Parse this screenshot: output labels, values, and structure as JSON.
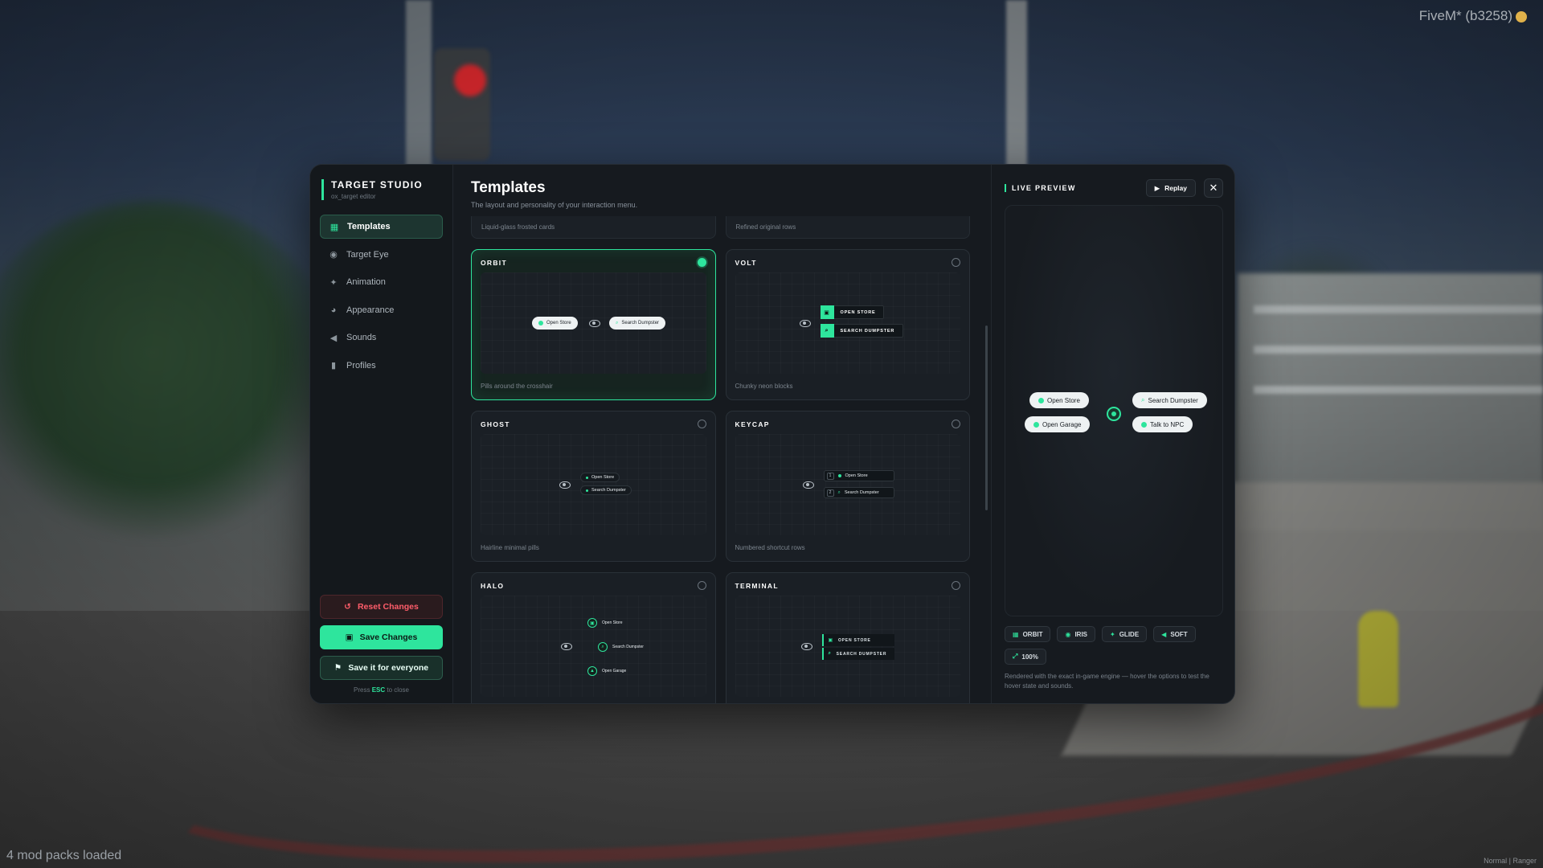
{
  "overlay": {
    "fivem_label": "FiveM* (b3258)",
    "mods_loaded": "4 mod packs loaded",
    "corner_note": "Normal | Ranger"
  },
  "brand": {
    "title": "TARGET STUDIO",
    "subtitle": "ox_target editor"
  },
  "sidebar": {
    "items": [
      {
        "label": "Templates",
        "icon": "grid-icon",
        "active": true
      },
      {
        "label": "Target Eye",
        "icon": "eye-icon"
      },
      {
        "label": "Animation",
        "icon": "wand-icon"
      },
      {
        "label": "Appearance",
        "icon": "palette-icon"
      },
      {
        "label": "Sounds",
        "icon": "speaker-icon"
      },
      {
        "label": "Profiles",
        "icon": "bookmark-icon"
      }
    ],
    "reset_label": "Reset Changes",
    "save_label": "Save Changes",
    "save_all_label": "Save it for everyone",
    "esc_prefix": "Press",
    "esc_key": "ESC",
    "esc_suffix": "to close"
  },
  "main": {
    "title": "Templates",
    "subtitle": "The layout and personality of your interaction menu.",
    "partial_cards": [
      "Liquid-glass frosted cards",
      "Refined original rows"
    ],
    "cards": [
      {
        "name": "ORBIT",
        "desc": "Pills around the crosshair",
        "selected": true,
        "options": [
          "Open Store",
          "Search Dumpster"
        ]
      },
      {
        "name": "VOLT",
        "desc": "Chunky neon blocks",
        "selected": false,
        "options": [
          "OPEN STORE",
          "SEARCH DUMPSTER"
        ]
      },
      {
        "name": "GHOST",
        "desc": "Hairline minimal pills",
        "selected": false,
        "options": [
          "Open Store",
          "Search Dumpster"
        ]
      },
      {
        "name": "KEYCAP",
        "desc": "Numbered shortcut rows",
        "selected": false,
        "options": [
          "Open Store",
          "Search Dumpster"
        ],
        "keys": [
          "1",
          "2"
        ]
      },
      {
        "name": "HALO",
        "desc": "",
        "selected": false,
        "options": [
          "Open Store",
          "Search Dumpster",
          "Open Garage"
        ]
      },
      {
        "name": "TERMINAL",
        "desc": "",
        "selected": false,
        "options": [
          "OPEN STORE",
          "SEARCH DUMPSTER"
        ]
      }
    ]
  },
  "preview": {
    "title": "LIVE PREVIEW",
    "replay_label": "Replay",
    "options": [
      "Open Store",
      "Search Dumpster",
      "Open Garage",
      "Talk to NPC"
    ],
    "chips": [
      "ORBIT",
      "IRIS",
      "GLIDE",
      "SOFT",
      "100%"
    ],
    "note": "Rendered with the exact in-game engine — hover the options to test the hover state and sounds."
  },
  "colors": {
    "accent": "#2ee59d",
    "danger": "#ff5d6a",
    "panel": "#161a1f"
  }
}
